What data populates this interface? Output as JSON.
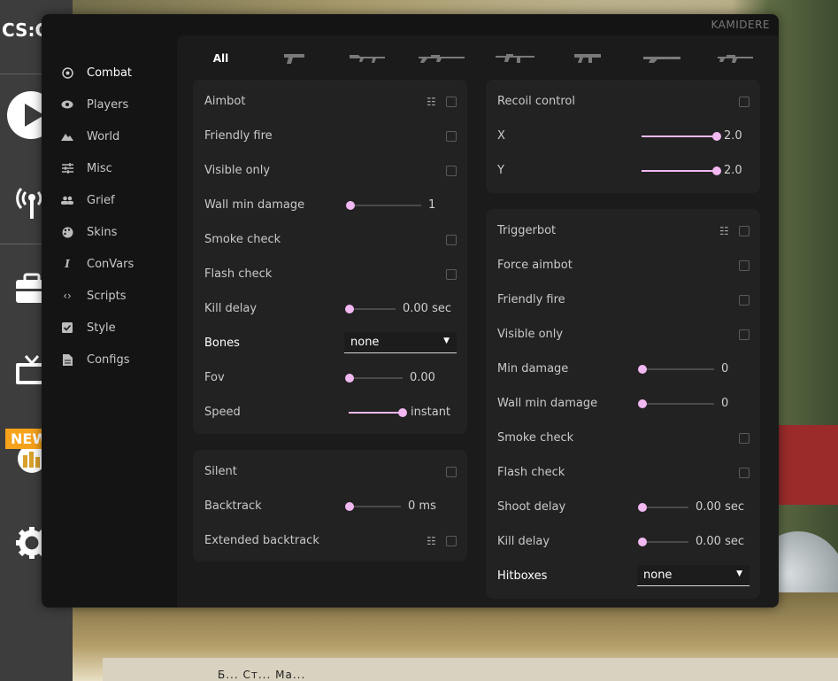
{
  "game": {
    "logo": "CS:GO",
    "new_badge": "NEW",
    "bottom_text": "Б...  Ст...  Ма..."
  },
  "window": {
    "brand": "KAMIDERE"
  },
  "nav": [
    {
      "label": "Combat",
      "icon": "target-icon",
      "active": true
    },
    {
      "label": "Players",
      "icon": "eye-icon"
    },
    {
      "label": "World",
      "icon": "mountain-icon"
    },
    {
      "label": "Misc",
      "icon": "sliders-icon"
    },
    {
      "label": "Grief",
      "icon": "people-icon"
    },
    {
      "label": "Skins",
      "icon": "palette-icon"
    },
    {
      "label": "ConVars",
      "icon": "italic-icon"
    },
    {
      "label": "Scripts",
      "icon": "code-icon"
    },
    {
      "label": "Style",
      "icon": "check-box-icon"
    },
    {
      "label": "Configs",
      "icon": "document-icon"
    }
  ],
  "weapon_tabs": {
    "all_label": "All",
    "icons": [
      "pistol-icon",
      "rifle-icon",
      "sniper-icon",
      "smg-icon",
      "shotgun-icon",
      "heavy-icon",
      "auto-sniper-icon"
    ]
  },
  "aimbot": {
    "title": "Aimbot",
    "friendly_fire": "Friendly fire",
    "visible_only": "Visible only",
    "wall_min_damage": {
      "label": "Wall min damage",
      "value": "1",
      "fraction": 0.0
    },
    "smoke_check": "Smoke check",
    "flash_check": "Flash check",
    "kill_delay": {
      "label": "Kill delay",
      "value": "0.00 sec",
      "fraction": 0.0
    },
    "bones": {
      "label": "Bones",
      "value": "none"
    },
    "fov": {
      "label": "Fov",
      "value": "0.00",
      "fraction": 0.0
    },
    "speed": {
      "label": "Speed",
      "value": "instant",
      "fraction": 1.0
    }
  },
  "silent": {
    "silent": "Silent",
    "backtrack": {
      "label": "Backtrack",
      "value": "0 ms",
      "fraction": 0.0
    },
    "extended_backtrack": "Extended backtrack"
  },
  "recoil": {
    "title": "Recoil control",
    "x": {
      "label": "X",
      "value": "2.0",
      "fraction": 1.0
    },
    "y": {
      "label": "Y",
      "value": "2.0",
      "fraction": 1.0
    }
  },
  "triggerbot": {
    "title": "Triggerbot",
    "force_aimbot": "Force aimbot",
    "friendly_fire": "Friendly fire",
    "visible_only": "Visible only",
    "min_damage": {
      "label": "Min damage",
      "value": "0",
      "fraction": 0.0
    },
    "wall_min_damage": {
      "label": "Wall min damage",
      "value": "0",
      "fraction": 0.0
    },
    "smoke_check": "Smoke check",
    "flash_check": "Flash check",
    "shoot_delay": {
      "label": "Shoot delay",
      "value": "0.00 sec",
      "fraction": 0.0
    },
    "kill_delay": {
      "label": "Kill delay",
      "value": "0.00 sec",
      "fraction": 0.0
    },
    "hitboxes": {
      "label": "Hitboxes",
      "value": "none"
    }
  },
  "colors": {
    "accent": "#f2b8f2",
    "panel": "#222222",
    "window": "#141414"
  }
}
